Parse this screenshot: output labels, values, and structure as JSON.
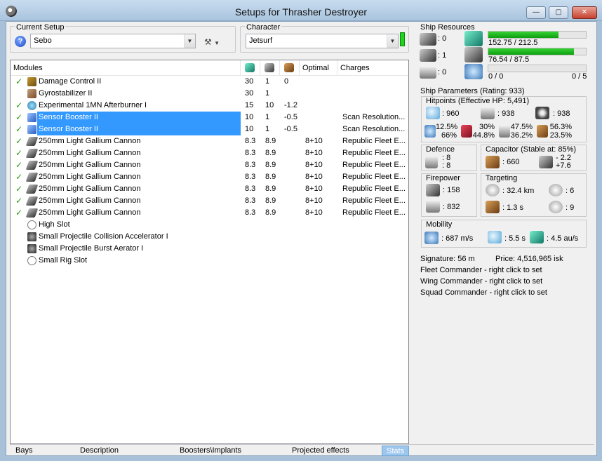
{
  "window": {
    "title": "Setups for Thrasher Destroyer",
    "min_label": "—",
    "max_label": "▢",
    "close_label": "✕"
  },
  "setup": {
    "label": "Current Setup",
    "value": "Sebo"
  },
  "character": {
    "label": "Character",
    "value": "Jetsurf"
  },
  "modules": {
    "headers": [
      "Modules",
      "",
      "",
      "",
      "Optimal",
      "Charges"
    ],
    "rows": [
      {
        "checked": true,
        "icon": "damage-control-icon",
        "name": "Damage Control II",
        "cpu": "30",
        "pg": "1",
        "cap": "0",
        "optimal": "",
        "charges": ""
      },
      {
        "checked": false,
        "icon": "gyrostabilizer-icon",
        "name": "Gyrostabilizer II",
        "cpu": "30",
        "pg": "1",
        "cap": "",
        "optimal": "",
        "charges": ""
      },
      {
        "checked": true,
        "icon": "afterburner-icon",
        "name": "Experimental 1MN Afterburner I",
        "cpu": "15",
        "pg": "10",
        "cap": "-1.2",
        "optimal": "",
        "charges": ""
      },
      {
        "checked": true,
        "icon": "sensor-booster-icon",
        "name": "Sensor Booster II",
        "cpu": "10",
        "pg": "1",
        "cap": "-0.5",
        "optimal": "",
        "charges": "Scan Resolution...",
        "selected": true
      },
      {
        "checked": true,
        "icon": "sensor-booster-icon",
        "name": "Sensor Booster II",
        "cpu": "10",
        "pg": "1",
        "cap": "-0.5",
        "optimal": "",
        "charges": "Scan Resolution...",
        "selected": true
      },
      {
        "checked": true,
        "icon": "gun-icon",
        "name": "250mm Light Gallium Cannon",
        "cpu": "8.3",
        "pg": "8.9",
        "cap": "",
        "optimal": "8+10",
        "charges": "Republic Fleet E..."
      },
      {
        "checked": true,
        "icon": "gun-icon",
        "name": "250mm Light Gallium Cannon",
        "cpu": "8.3",
        "pg": "8.9",
        "cap": "",
        "optimal": "8+10",
        "charges": "Republic Fleet E..."
      },
      {
        "checked": true,
        "icon": "gun-icon",
        "name": "250mm Light Gallium Cannon",
        "cpu": "8.3",
        "pg": "8.9",
        "cap": "",
        "optimal": "8+10",
        "charges": "Republic Fleet E..."
      },
      {
        "checked": true,
        "icon": "gun-icon",
        "name": "250mm Light Gallium Cannon",
        "cpu": "8.3",
        "pg": "8.9",
        "cap": "",
        "optimal": "8+10",
        "charges": "Republic Fleet E..."
      },
      {
        "checked": true,
        "icon": "gun-icon",
        "name": "250mm Light Gallium Cannon",
        "cpu": "8.3",
        "pg": "8.9",
        "cap": "",
        "optimal": "8+10",
        "charges": "Republic Fleet E..."
      },
      {
        "checked": true,
        "icon": "gun-icon",
        "name": "250mm Light Gallium Cannon",
        "cpu": "8.3",
        "pg": "8.9",
        "cap": "",
        "optimal": "8+10",
        "charges": "Republic Fleet E..."
      },
      {
        "checked": true,
        "icon": "gun-icon",
        "name": "250mm Light Gallium Cannon",
        "cpu": "8.3",
        "pg": "8.9",
        "cap": "",
        "optimal": "8+10",
        "charges": "Republic Fleet E..."
      },
      {
        "checked": false,
        "icon": "high-slot-icon",
        "name": "High Slot",
        "cpu": "",
        "pg": "",
        "cap": "",
        "optimal": "",
        "charges": ""
      },
      {
        "checked": false,
        "icon": "rig-icon",
        "name": "Small Projectile Collision Accelerator I",
        "cpu": "",
        "pg": "",
        "cap": "",
        "optimal": "",
        "charges": ""
      },
      {
        "checked": false,
        "icon": "rig-icon",
        "name": "Small Projectile Burst Aerator I",
        "cpu": "",
        "pg": "",
        "cap": "",
        "optimal": "",
        "charges": ""
      },
      {
        "checked": false,
        "icon": "rig-slot-icon",
        "name": "Small Rig Slot",
        "cpu": "",
        "pg": "",
        "cap": "",
        "optimal": "",
        "charges": ""
      }
    ]
  },
  "tabs": [
    {
      "label": "Bays",
      "active": false
    },
    {
      "label": "Description",
      "active": false
    },
    {
      "label": "Boosters\\Implants",
      "active": false
    },
    {
      "label": "Projected effects",
      "active": false
    },
    {
      "label": "Stats",
      "active": true
    }
  ],
  "resources": {
    "label": "Ship Resources",
    "turret_slots": ": 0",
    "launcher_slots": ": 1",
    "drone_slots": ": 0",
    "cpu_text": "152.75 / 212.5",
    "cpu_fraction": 0.719,
    "pg_text": "76.54 / 87.5",
    "pg_fraction": 0.875,
    "drone_bay_text": "0 / 0",
    "drone_bw_text": "0 / 5",
    "drone_fraction": 0
  },
  "parameters": {
    "label": "Ship Parameters (Rating: 933)",
    "hitpoints": {
      "label": "Hitpoints (Effective HP: 5,491)",
      "shield": ": 960",
      "armor": ": 938",
      "structure": ": 938",
      "resists": [
        {
          "top": "12.5%",
          "bottom": "66%"
        },
        {
          "top": "30%",
          "bottom": "44.8%"
        },
        {
          "top": "47.5%",
          "bottom": "36.2%"
        },
        {
          "top": "56.3%",
          "bottom": "23.5%"
        }
      ]
    },
    "defence": {
      "label": "Defence",
      "a": ": 8",
      "b": ": 8"
    },
    "capacitor": {
      "label": "Capacitor (Stable at: 85%)",
      "amount": ": 660",
      "delta_top": "- 2.2",
      "delta_bottom": "+7.6"
    },
    "firepower": {
      "label": "Firepower",
      "dps": ": 158",
      "volley": ": 832"
    },
    "targeting": {
      "label": "Targeting",
      "range": ": 32.4 km",
      "targets": ": 6",
      "lock_time": ": 1.3 s",
      "scan": ": 9"
    },
    "mobility": {
      "label": "Mobility",
      "speed": ": 687 m/s",
      "align": ": 5.5 s",
      "warp": ": 4.5 au/s"
    },
    "signature": "Signature: 56 m",
    "price": "Price: 4,516,965 isk",
    "fleet_commander": "Fleet Commander - right click to set",
    "wing_commander": "Wing Commander - right click to set",
    "squad_commander": "Squad Commander - right click to set"
  }
}
